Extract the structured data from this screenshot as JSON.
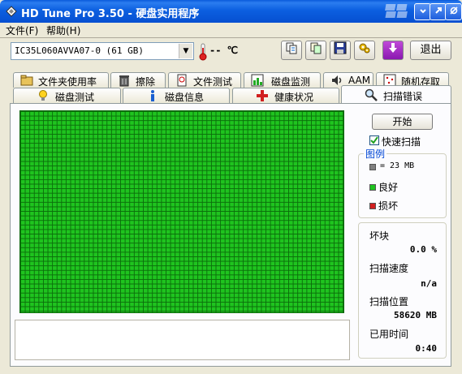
{
  "window": {
    "title": "HD Tune Pro 3.50 - 硬盘实用程序"
  },
  "menu": {
    "file": "文件(F)",
    "help": "帮助(H)"
  },
  "toolbar": {
    "drive": "IC35L060AVVA07-0 (61 GB)",
    "temperature": "-- ℃",
    "exit_label": "退出"
  },
  "tabs_row1": [
    {
      "label": "文件夹使用率",
      "icon": "folder-icon"
    },
    {
      "label": "擦除",
      "icon": "trash-icon"
    },
    {
      "label": "文件测试",
      "icon": "file-test-icon"
    },
    {
      "label": "磁盘监测",
      "icon": "chart-icon"
    },
    {
      "label": "AAM",
      "icon": "speaker-icon"
    },
    {
      "label": "随机存取",
      "icon": "random-access-icon"
    }
  ],
  "tabs_row2": [
    {
      "label": "磁盘测试",
      "icon": "bulb-icon"
    },
    {
      "label": "磁盘信息",
      "icon": "info-icon"
    },
    {
      "label": "健康状况",
      "icon": "health-cross-icon"
    },
    {
      "label": "扫描错误",
      "icon": "magnifier-icon",
      "active": true
    }
  ],
  "scan": {
    "start_label": "开始",
    "quick_scan_label": "快速扫描",
    "quick_scan_checked": true,
    "legend_title": "图例",
    "legend_block": "= 23 MB",
    "legend_good": "良好",
    "legend_bad": "损坏",
    "bad_blocks_label": "坏块",
    "bad_blocks_value": "0.0 %",
    "speed_label": "扫描速度",
    "speed_value": "n/a",
    "position_label": "扫描位置",
    "position_value": "58620 MB",
    "elapsed_label": "已用时间",
    "elapsed_value": "0:40"
  },
  "colors": {
    "good": "#1fc41f",
    "bad": "#d11f1f",
    "block": "#808080",
    "titlebar": "#0a5bdb"
  }
}
